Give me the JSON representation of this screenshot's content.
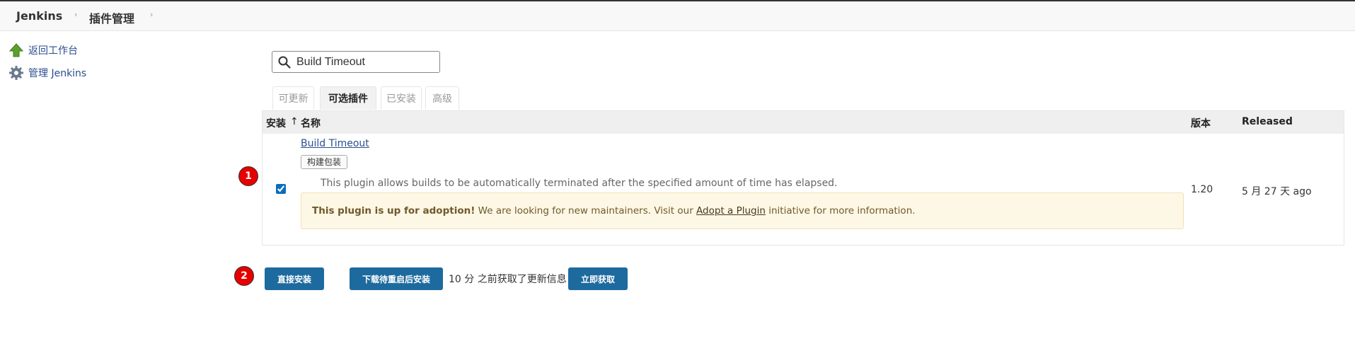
{
  "breadcrumb": {
    "home": "Jenkins",
    "current": "插件管理",
    "separator": "›"
  },
  "sidebar": {
    "items": [
      {
        "label": "返回工作台",
        "icon": "up-arrow-icon"
      },
      {
        "label": "管理 Jenkins",
        "icon": "gear-icon"
      }
    ]
  },
  "search": {
    "value": "Build Timeout",
    "placeholder": ""
  },
  "tabs": [
    {
      "label": "可更新",
      "active": false
    },
    {
      "label": "可选插件",
      "active": true
    },
    {
      "label": "已安装",
      "active": false
    },
    {
      "label": "高级",
      "active": false
    }
  ],
  "table": {
    "headers": {
      "install": "安装",
      "sort_indicator": "↑",
      "name": "名称",
      "version": "版本",
      "released": "Released"
    },
    "rows": [
      {
        "checked": true,
        "name": "Build Timeout",
        "label": "构建包装",
        "description": "This plugin allows builds to be automatically terminated after the specified amount of time has elapsed.",
        "adoption": {
          "bold": "This plugin is up for adoption!",
          "text1": " We are looking for new maintainers. Visit our ",
          "link": "Adopt a Plugin",
          "text2": " initiative for more information."
        },
        "version": "1.20",
        "released": "5 月 27 天 ago"
      }
    ]
  },
  "annotations": {
    "badge1": "1",
    "badge2": "2"
  },
  "actions": {
    "install_now": "直接安装",
    "download_restart": "下载待重启后安装",
    "updated_info": "10 分 之前获取了更新信息",
    "fetch_now": "立即获取"
  },
  "colors": {
    "primary_button": "#1d6a9e",
    "link": "#2b4e8f",
    "adoption_bg": "#fdf7e6",
    "badge": "#e60000"
  }
}
